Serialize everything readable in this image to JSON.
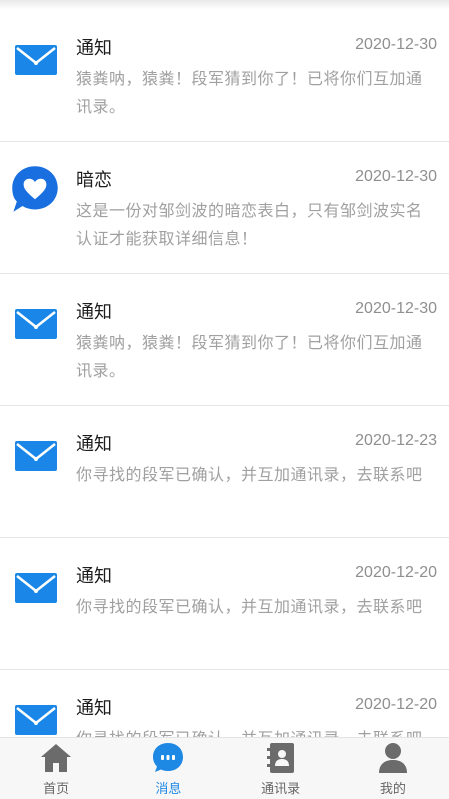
{
  "colors": {
    "accent": "#1e88e5",
    "icon_blue": "#1a87e8",
    "text_gray": "#a0a0a0"
  },
  "messages": [
    {
      "icon": "mail-icon",
      "title": "通知",
      "date": "2020-12-30",
      "body": "猿粪呐，猿粪！段军猜到你了！已将你们互加通讯录。"
    },
    {
      "icon": "heart-chat-icon",
      "title": "暗恋",
      "date": "2020-12-30",
      "body": "这是一份对邹剑波的暗恋表白，只有邹剑波实名认证才能获取详细信息！"
    },
    {
      "icon": "mail-icon",
      "title": "通知",
      "date": "2020-12-30",
      "body": "猿粪呐，猿粪！段军猜到你了！已将你们互加通讯录。"
    },
    {
      "icon": "mail-icon",
      "title": "通知",
      "date": "2020-12-23",
      "body": "你寻找的段军已确认，并互加通讯录，去联系吧"
    },
    {
      "icon": "mail-icon",
      "title": "通知",
      "date": "2020-12-20",
      "body": "你寻找的段军已确认，并互加通讯录，去联系吧"
    },
    {
      "icon": "mail-icon",
      "title": "通知",
      "date": "2020-12-20",
      "body": "你寻找的段军已确认，并互加通讯录，去联系吧"
    }
  ],
  "tabbar": {
    "home": {
      "label": "首页",
      "icon": "home-icon"
    },
    "messages": {
      "label": "消息",
      "icon": "chat-bubble-icon",
      "active": true
    },
    "contacts": {
      "label": "通讯录",
      "icon": "address-book-icon"
    },
    "mine": {
      "label": "我的",
      "icon": "person-icon"
    }
  }
}
